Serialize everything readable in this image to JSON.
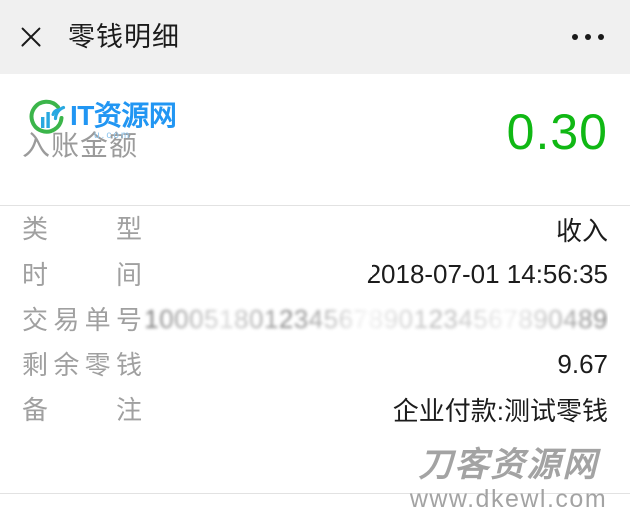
{
  "titlebar": {
    "close_icon": "close-icon",
    "title": "零钱明细",
    "more_icon": "more-options-icon"
  },
  "amount": {
    "label": "入账金额",
    "value": "0.30",
    "color": "#10b814"
  },
  "details": {
    "rows": [
      {
        "label": "类型",
        "value": "收入",
        "masked": false
      },
      {
        "label": "时间",
        "value": "2018-07-01 14:56:35",
        "masked": false
      },
      {
        "label": "交易单号",
        "value": "1000518012345678901234567890489",
        "masked": true
      },
      {
        "label": "剩余零钱",
        "value": "9.67",
        "masked": false
      },
      {
        "label": "备注",
        "value": "企业付款:测试零钱",
        "masked": false
      }
    ]
  },
  "watermarks": {
    "logo": {
      "brand": "IT资源网",
      "url": "u.com",
      "ring_color": "#3bb54a",
      "signal_color": "#29a8e0",
      "text_color": "#2196f3"
    },
    "bottom": {
      "name": "刀客资源网",
      "url": "www.dkewl.com",
      "color": "#9c9c9c"
    }
  }
}
